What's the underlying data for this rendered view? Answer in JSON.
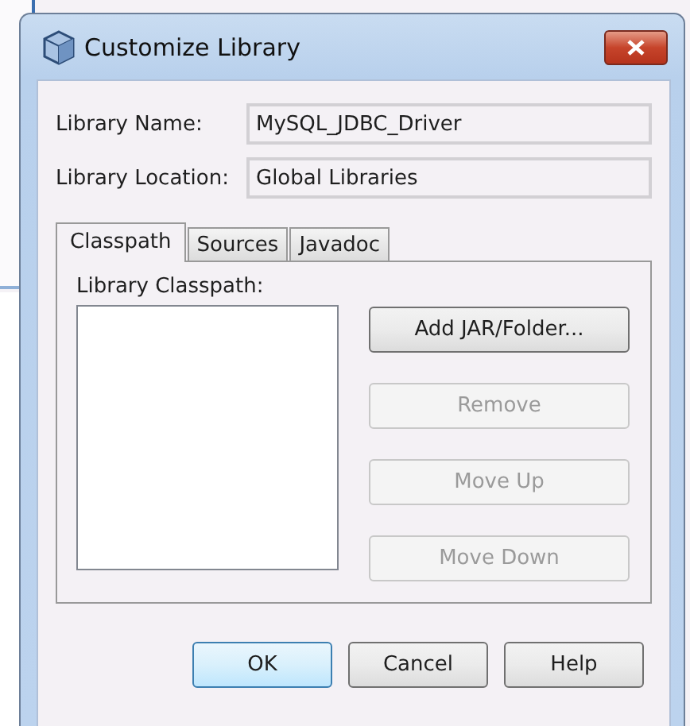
{
  "window": {
    "title": "Customize Library"
  },
  "fields": [
    {
      "label": "Library Name:",
      "value": "MySQL_JDBC_Driver"
    },
    {
      "label": "Library Location:",
      "value": "Global Libraries"
    }
  ],
  "tabs": [
    {
      "label": "Classpath",
      "selected": true
    },
    {
      "label": "Sources",
      "selected": false
    },
    {
      "label": "Javadoc",
      "selected": false
    }
  ],
  "classpath": {
    "label": "Library Classpath:"
  },
  "side_buttons": [
    {
      "label": "Add JAR/Folder...",
      "disabled": false
    },
    {
      "label": "Remove",
      "disabled": true
    },
    {
      "label": "Move Up",
      "disabled": true
    },
    {
      "label": "Move Down",
      "disabled": true
    }
  ],
  "buttons": [
    {
      "label": "OK",
      "default": true
    },
    {
      "label": "Cancel",
      "default": false
    },
    {
      "label": "Help",
      "default": false
    }
  ]
}
